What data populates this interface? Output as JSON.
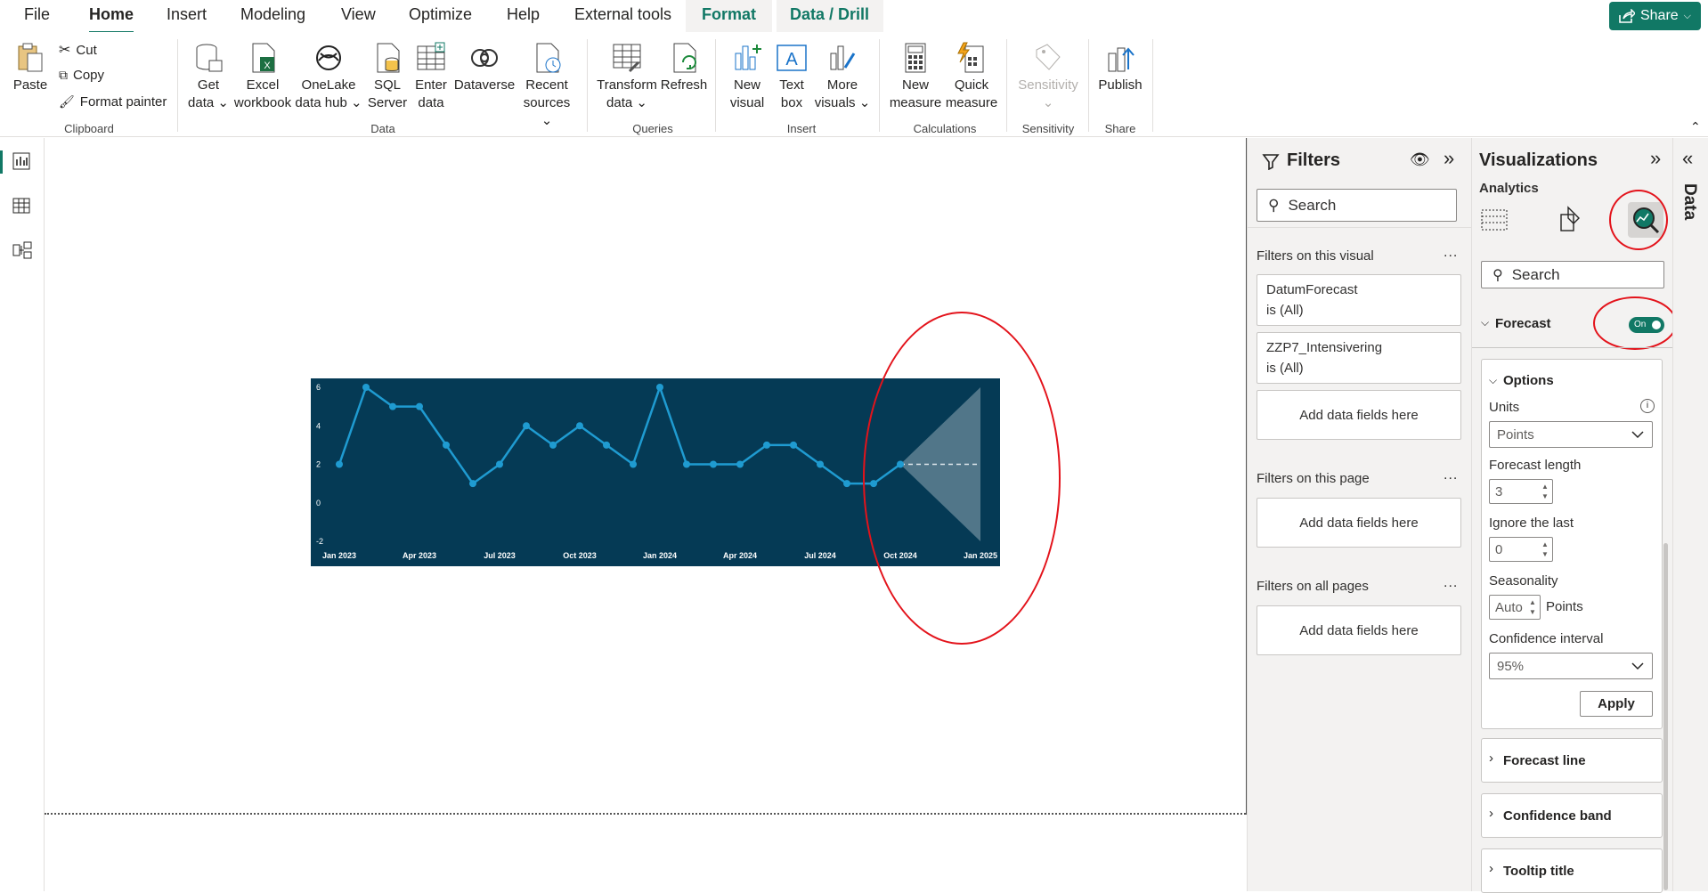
{
  "menu": {
    "items": [
      "File",
      "Home",
      "Insert",
      "Modeling",
      "View",
      "Optimize",
      "Help",
      "External tools",
      "Format",
      "Data / Drill"
    ],
    "active": "Home",
    "share_label": "Share"
  },
  "ribbon": {
    "clipboard": {
      "paste": "Paste",
      "cut": "Cut",
      "copy": "Copy",
      "format_painter": "Format painter",
      "group": "Clipboard"
    },
    "data": {
      "get_data": [
        "Get",
        "data"
      ],
      "excel": [
        "Excel",
        "workbook"
      ],
      "onelake": [
        "OneLake",
        "data hub"
      ],
      "sql": [
        "SQL",
        "Server"
      ],
      "enter": [
        "Enter",
        "data"
      ],
      "dataverse": "Dataverse",
      "recent": [
        "Recent",
        "sources"
      ],
      "group": "Data"
    },
    "queries": {
      "transform": [
        "Transform",
        "data"
      ],
      "refresh": "Refresh",
      "group": "Queries"
    },
    "insert": {
      "new_visual": [
        "New",
        "visual"
      ],
      "text_box": [
        "Text",
        "box"
      ],
      "more_visuals": [
        "More",
        "visuals"
      ],
      "group": "Insert"
    },
    "calculations": {
      "new_measure": [
        "New",
        "measure"
      ],
      "quick_measure": [
        "Quick",
        "measure"
      ],
      "group": "Calculations"
    },
    "sensitivity": {
      "label": "Sensitivity",
      "group": "Sensitivity"
    },
    "share": {
      "publish": "Publish",
      "group": "Share"
    }
  },
  "chart_data": {
    "type": "line",
    "x": [
      "Jan 2023",
      "Feb 2023",
      "Mar 2023",
      "Apr 2023",
      "May 2023",
      "Jun 2023",
      "Jul 2023",
      "Aug 2023",
      "Sep 2023",
      "Oct 2023",
      "Nov 2023",
      "Dec 2023",
      "Jan 2024",
      "Feb 2024",
      "Mar 2024",
      "Apr 2024",
      "May 2024",
      "Jun 2024",
      "Jul 2024",
      "Aug 2024",
      "Sep 2024",
      "Oct 2024"
    ],
    "values": [
      2,
      6,
      5,
      5,
      3,
      1,
      2,
      4,
      3,
      4,
      3,
      2,
      6,
      2,
      2,
      2,
      3,
      3,
      2,
      1,
      1,
      2
    ],
    "forecast": {
      "x": [
        "Oct 2024",
        "Jan 2025"
      ],
      "values": [
        2,
        2
      ],
      "upper": [
        2,
        6
      ],
      "lower": [
        2,
        -2
      ]
    },
    "x_ticks": [
      "Jan 2023",
      "Apr 2023",
      "Jul 2023",
      "Oct 2023",
      "Jan 2024",
      "Apr 2024",
      "Jul 2024",
      "Oct 2024",
      "Jan 2025"
    ],
    "y_ticks": [
      6,
      4,
      2,
      0,
      -2
    ],
    "ylim": [
      -2,
      6
    ],
    "colors": {
      "background": "#053a55",
      "line": "#1f9bd1",
      "forecast": "#dfe7ec"
    }
  },
  "filters": {
    "title": "Filters",
    "search_placeholder": "Search",
    "on_visual": "Filters on this visual",
    "cards": [
      {
        "name": "DatumForecast",
        "state": "is (All)"
      },
      {
        "name": "ZZP7_Intensivering",
        "state": "is (All)"
      }
    ],
    "add_fields": "Add data fields here",
    "on_page": "Filters on this page",
    "on_all_pages": "Filters on all pages"
  },
  "viz": {
    "title": "Visualizations",
    "subtitle": "Analytics",
    "search_placeholder": "Search",
    "forecast_label": "Forecast",
    "toggle_label": "On",
    "options_title": "Options",
    "units_label": "Units",
    "units_value": "Points",
    "forecast_length_label": "Forecast length",
    "forecast_length_value": "3",
    "ignore_last_label": "Ignore the last",
    "ignore_last_value": "0",
    "seasonality_label": "Seasonality",
    "seasonality_value": "Auto",
    "seasonality_unit": "Points",
    "confidence_label": "Confidence interval",
    "confidence_value": "95%",
    "apply_label": "Apply",
    "sections": [
      "Forecast line",
      "Confidence band",
      "Tooltip title"
    ]
  },
  "data_rail": {
    "label": "Data"
  }
}
